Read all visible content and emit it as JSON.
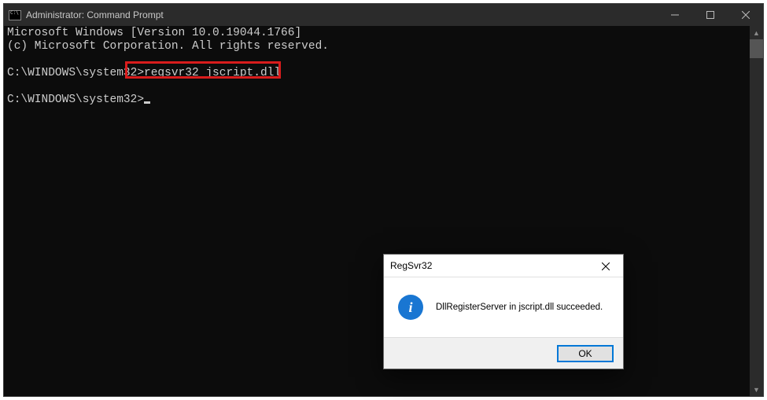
{
  "window": {
    "title": "Administrator: Command Prompt"
  },
  "terminal": {
    "line1": "Microsoft Windows [Version 10.0.19044.1766]",
    "line2": "(c) Microsoft Corporation. All rights reserved.",
    "prompt1_prefix": "C:\\WINDOWS\\system32>",
    "prompt1_cmd": "regsvr32 jscript.dll",
    "prompt2_prefix": "C:\\WINDOWS\\system32>"
  },
  "dialog": {
    "title": "RegSvr32",
    "message": "DllRegisterServer in jscript.dll succeeded.",
    "ok_label": "OK"
  },
  "icons": {
    "info_glyph": "i"
  },
  "highlight": {
    "color": "#d91c1c"
  }
}
